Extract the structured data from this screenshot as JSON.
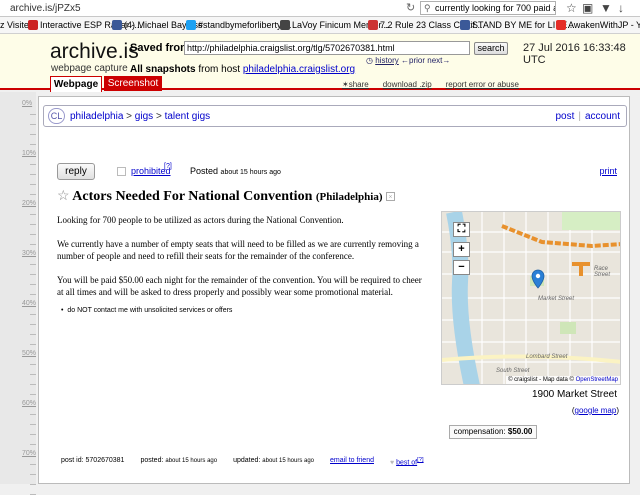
{
  "browser": {
    "url": "archive.is/jPZx5",
    "search_text": "currently looking for 700 paid actors"
  },
  "bookmarks": [
    {
      "label": "z Visited",
      "color": "#777777"
    },
    {
      "label": "Interactive ESP Radar -...",
      "color": "#cc2222"
    },
    {
      "label": "(4) Michael Bayless",
      "color": "#3b5998"
    },
    {
      "label": "#standbymeforliberty ...",
      "color": "#1da1f2"
    },
    {
      "label": "LaVoy Finicum Memor...",
      "color": "#444444"
    },
    {
      "label": "7.2 Rule 23 Class Certif...",
      "color": "#cc3333"
    },
    {
      "label": "STAND BY ME for LIBE...",
      "color": "#3b5998"
    },
    {
      "label": "AwakenWithJP - YouT...",
      "color": "#e52d27"
    }
  ],
  "archive": {
    "logo": "archive.is",
    "logo_sub": "webpage capture",
    "saved_from_label": "Saved from",
    "saved_url": "http://philadelphia.craigslist.org/tlg/5702670381.html",
    "search_button": "search",
    "datetime": "27 Jul 2016 16:33:48 UTC",
    "history": "history",
    "prev": "←prior",
    "next": "next→",
    "all_snapshots_label": "All snapshots",
    "from_host_label": "from host",
    "host": "philadelphia.craigslist.org",
    "tab_webpage": "Webpage",
    "tab_screenshot": "Screenshot",
    "share": "share",
    "download": "download .zip",
    "report": "report error or abuse"
  },
  "ruler": [
    "0%",
    "10%",
    "20%",
    "30%",
    "40%",
    "50%",
    "60%",
    "70%"
  ],
  "craigslist": {
    "logo": "CL",
    "crumb_city": "philadelphia",
    "crumb_sep": ">",
    "crumb_gigs": "gigs",
    "crumb_talent": "talent gigs",
    "post": "post",
    "account": "account",
    "reply": "reply",
    "prohibited": "prohibited",
    "prohibited_q": "[?]",
    "posted_label": "Posted",
    "posted_time": "about 15 hours ago",
    "print": "print",
    "title": "Actors Needed For National Convention",
    "location": "(Philadelphia)",
    "star": "☆",
    "hide": "×",
    "body": [
      "Looking for 700 people to be utilized as actors during the National Convention.",
      "We currently have a number of empty seats that will need to be filled as we are currently removing a number of people and need to refill their seats for the remainder of the conference.",
      "You will be paid $50.00 each night for the remainder of the convention. You will be required to cheer at all times and will be asked to dress properly and possibly wear some promotional material."
    ],
    "bullet": "do NOT contact me with unsolicited services or offers",
    "map_attr_prefix": "© craigslist - Map data ©",
    "map_attr_link": "OpenStreetMap",
    "streets": [
      "Race Street",
      "Market Street",
      "Lombard Street",
      "South Street"
    ],
    "address": "1900 Market Street",
    "google_map": "google map",
    "comp_label": "compensation:",
    "comp_value": "$50.00",
    "footer": {
      "post_id": "post id: 5702670381",
      "posted_label": "posted:",
      "posted_time": "about 15 hours ago",
      "updated_label": "updated:",
      "updated_time": "about 15 hours ago",
      "email": "email to friend",
      "best_of": "best of",
      "best_of_q": "[?]"
    }
  },
  "colors": {
    "archive_red": "#cc0000",
    "header_bg": "#fefde8",
    "link": "#0000cc",
    "map_route": "#e8912d",
    "map_pin": "#2a7fd6",
    "river": "#a9d3e8"
  }
}
